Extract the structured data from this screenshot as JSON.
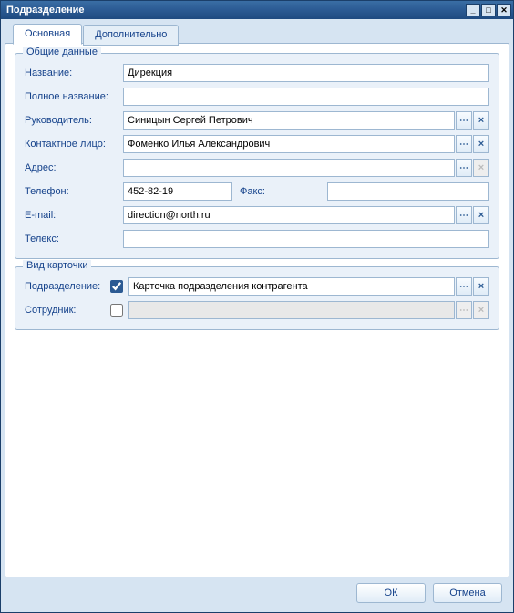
{
  "window": {
    "title": "Подразделение",
    "minimize_glyph": "_",
    "maximize_glyph": "□",
    "close_glyph": "✕"
  },
  "tabs": {
    "main": "Основная",
    "extra": "Дополнительно"
  },
  "groups": {
    "general": {
      "legend": "Общие данные",
      "labels": {
        "name": "Название:",
        "full_name": "Полное название:",
        "manager": "Руководитель:",
        "contact": "Контактное лицо:",
        "address": "Адрес:",
        "phone": "Телефон:",
        "fax": "Факс:",
        "email": "E-mail:",
        "telex": "Телекс:"
      },
      "values": {
        "name": "Дирекция",
        "full_name": "",
        "manager": "Синицын Сергей Петрович",
        "contact": "Фоменко Илья Александрович",
        "address": "",
        "phone": "452-82-19",
        "fax": "",
        "email": "direction@north.ru",
        "telex": ""
      }
    },
    "card": {
      "legend": "Вид карточки",
      "labels": {
        "department": "Подразделение:",
        "employee": "Сотрудник:"
      },
      "values": {
        "department_checked": true,
        "department": "Карточка подразделения контрагента",
        "employee_checked": false,
        "employee": ""
      }
    }
  },
  "footer": {
    "ok": "ОК",
    "cancel": "Отмена"
  },
  "icons": {
    "ellipsis": "⋯",
    "clear": "×"
  }
}
